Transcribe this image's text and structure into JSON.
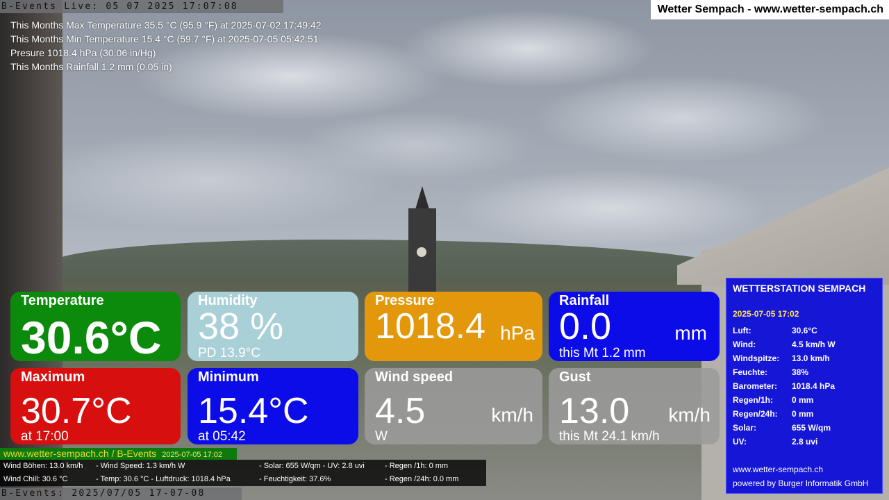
{
  "top_bar": {
    "live_text": "B-Events Live: 05 07 2025 17:07:08",
    "site_title": "Wetter Sempach - www.wetter-sempach.ch"
  },
  "stats": [
    "This Months Max Temperature 35.5 °C (95.9 °F) at 2025-07-02 17:49:42",
    "This Months Min Temperature 15.4 °C (59.7 °F) at 2025-07-05 05:42:51",
    "Presure 1018.4 hPa (30.06 in/Hg)",
    "This Months Rainfall 1.2 mm (0.05 in)"
  ],
  "tiles": {
    "temperature": {
      "label": "Temperature",
      "value": "30.6°C",
      "color": "#0b8a0b"
    },
    "humidity": {
      "label": "Humidity",
      "value": "38 %",
      "sub": "PD 13.9°C",
      "color": "#a9cfd7"
    },
    "pressure": {
      "label": "Pressure",
      "value": "1018.4",
      "unit": "hPa",
      "color": "#e3980c"
    },
    "rainfall": {
      "label": "Rainfall",
      "value": "0.0",
      "unit": "mm",
      "sub": "this Mt 1.2 mm",
      "color": "#0c0ce8"
    },
    "maximum": {
      "label": "Maximum",
      "value": "30.7°C",
      "sub": "at 17:00",
      "color": "#d70f0f"
    },
    "minimum": {
      "label": "Minimum",
      "value": "15.4°C",
      "sub": "at 05:42",
      "color": "#0c0ce8"
    },
    "wind_speed": {
      "label": "Wind speed",
      "value": "4.5",
      "unit": "km/h",
      "sub": "W",
      "color": "#9b9b9b"
    },
    "gust": {
      "label": "Gust",
      "value": "13.0",
      "unit": "km/h",
      "sub": "this Mt 24.1 km/h",
      "color": "#9b9b9b"
    }
  },
  "credit": {
    "text": "www.wetter-sempach.ch / B-Events",
    "timestamp": "2025-07-05 17:02"
  },
  "ticker": {
    "wind_boeen": "Wind Böhen: 13.0 km/h",
    "wind_speed": "- Wind Speed: 1.3 km/h W",
    "solar_uv": "- Solar: 655 W/qm   - UV: 2.8 uvi",
    "regen_1h": "- Regen /1h:   0 mm",
    "wind_chill": "Wind Chill: 30.6 °C",
    "temp_druck": "- Temp: 30.6 °C  - Luftdruck: 1018.4 hPa",
    "feuchtigkeit": "- Feuchtigkeit: 37.6%",
    "regen_24h": "- Regen /24h: 0.0 mm"
  },
  "bottom_bar": {
    "live_text": "B-Events: 2025/07/05 17-07-08"
  },
  "station": {
    "title": "WETTERSTATION SEMPACH",
    "date": "2025-07-05 17:02",
    "rows": [
      {
        "key": "Luft:",
        "value": "30.6°C"
      },
      {
        "key": "Wind:",
        "value": "4.5 km/h  W"
      },
      {
        "key": "Windspitze:",
        "value": "13.0 km/h"
      },
      {
        "key": "Feuchte:",
        "value": "38%"
      },
      {
        "key": "Barometer:",
        "value": "1018.4 hPa"
      },
      {
        "key": "Regen/1h:",
        "value": "0 mm"
      },
      {
        "key": "Regen/24h:",
        "value": "0 mm"
      },
      {
        "key": "Solar:",
        "value": "655 W/qm"
      },
      {
        "key": "UV:",
        "value": "2.8 uvi"
      }
    ],
    "footer_url": "www.wetter-sempach.ch",
    "footer_credit": "powered by Burger Informatik GmbH"
  }
}
